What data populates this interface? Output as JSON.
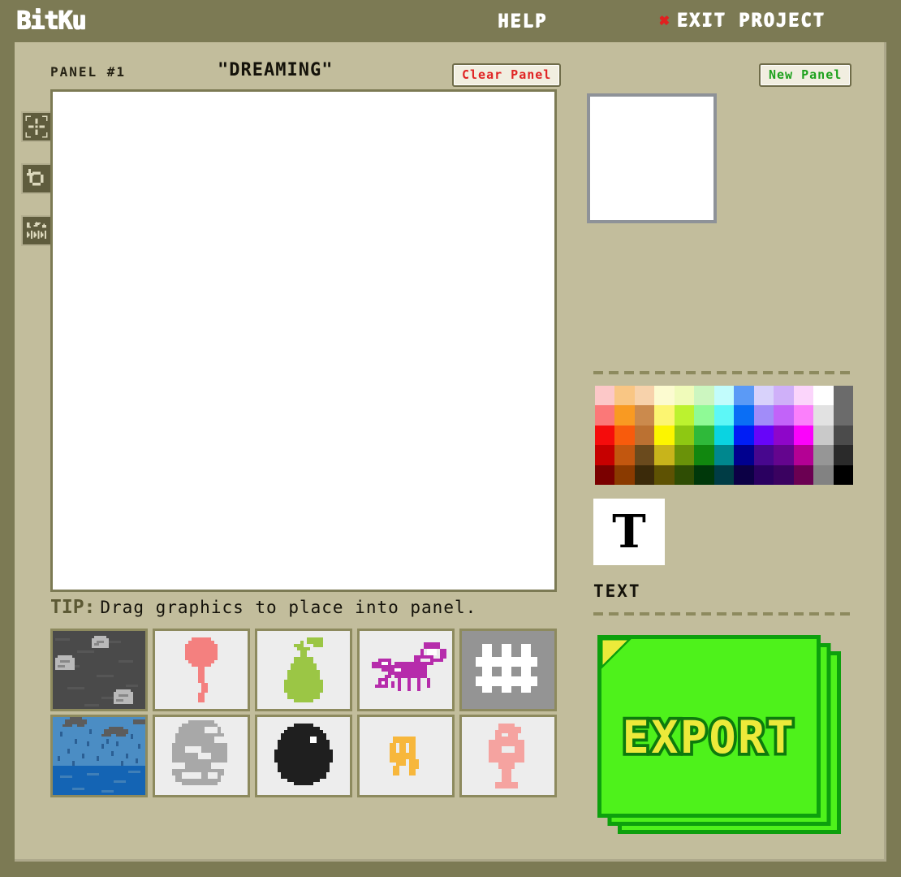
{
  "app": {
    "name": "BitKu",
    "background_color": "#7c7a54",
    "workspace_color": "#c2bd9c"
  },
  "topbar": {
    "logo": "BitKu",
    "help_label": "HELP",
    "exit_icon": "✖",
    "exit_label": "EXIT PROJECT",
    "exit_icon_color": "#e02020"
  },
  "panel_header": {
    "panel_label": "PANEL #1",
    "panel_title": "\"DREAMING\"",
    "clear_panel_label": "Clear Panel",
    "clear_panel_color": "#e02424",
    "new_panel_label": "New Panel",
    "new_panel_color": "#1da11d"
  },
  "tools": [
    {
      "name": "move-resize-tool",
      "icon": "move-arrows-icon"
    },
    {
      "name": "undo-tool",
      "icon": "undo-arrow-icon"
    },
    {
      "name": "frames-tool",
      "icon": "frames-icon"
    }
  ],
  "canvas": {
    "background": "#ffffff",
    "border_color": "#7c7a54"
  },
  "preview": {
    "background": "#ffffff",
    "border_color": "#8e9298"
  },
  "tip": {
    "key": "TIP:",
    "text": "Drag graphics to place into panel."
  },
  "sprites": [
    {
      "name": "rocks-ground-tile",
      "bg": "#4a4a4a",
      "accent": "#b9b9b9"
    },
    {
      "name": "balloon-sprite",
      "bg": "#ededed",
      "accent": "#f4807f"
    },
    {
      "name": "pear-sprite",
      "bg": "#ededed",
      "accent": "#9cc košek"
    },
    {
      "name": "scorpion-sprite",
      "bg": "#ededed",
      "accent": "#b62cab"
    },
    {
      "name": "fence-sprite",
      "bg": "#949494",
      "accent": "#ffffff"
    },
    {
      "name": "rain-sea-tile",
      "bg": "#4b8dc4",
      "accent": "#1464b4"
    },
    {
      "name": "boulder-sprite",
      "bg": "#ededed",
      "accent": "#a8a8a8"
    },
    {
      "name": "black-blob-sprite",
      "bg": "#ededed",
      "accent": "#1f1f1f"
    },
    {
      "name": "orange-critter-sprite",
      "bg": "#ededed",
      "accent": "#f7b73c"
    },
    {
      "name": "pink-robot-sprite",
      "bg": "#ededed",
      "accent": "#f5a3a0"
    }
  ],
  "palette": {
    "columns": 13,
    "rows": 5,
    "colors": [
      [
        "#fcc8c8",
        "#f9c684",
        "#f7d2ab",
        "#fcfbd0",
        "#f0fbba",
        "#ccf6c0",
        "#c2fcfc",
        "#5b9af6",
        "#d8d2fb",
        "#cfb0f9",
        "#fbd5fb",
        "#ffffff",
        "#6b6b6b"
      ],
      [
        "#fb7878",
        "#f99a22",
        "#cb8a4d",
        "#fcf571",
        "#bcf22f",
        "#8ffa96",
        "#5df7f7",
        "#0a6ef5",
        "#a18cf9",
        "#c263f9",
        "#fb7ffb",
        "#e2e2e2",
        "#6b6b6b"
      ],
      [
        "#f50c0c",
        "#f85b0c",
        "#bb7132",
        "#fcf500",
        "#8ec812",
        "#2fb93a",
        "#0ad3e1",
        "#001df5",
        "#6705f9",
        "#8e06c9",
        "#fb03fb",
        "#c9c9c9",
        "#4b4b4b"
      ],
      [
        "#c60000",
        "#c2570f",
        "#6a4a1d",
        "#c8b41b",
        "#6a9209",
        "#11870f",
        "#00878e",
        "#00008e",
        "#47078e",
        "#64058e",
        "#b40194",
        "#969696",
        "#2a2a2a"
      ],
      [
        "#7a0000",
        "#8a3a00",
        "#3b2a0a",
        "#5e5203",
        "#2f4d04",
        "#00380a",
        "#003c45",
        "#0c0045",
        "#2a0060",
        "#3a0260",
        "#6b0052",
        "#828282",
        "#000000"
      ]
    ]
  },
  "text_tool": {
    "glyph": "T",
    "label": "TEXT"
  },
  "export": {
    "label": "EXPORT",
    "page_color": "#4ef21b",
    "outline_color": "#0da00d",
    "label_color": "#ecea3a",
    "fold_color": "#ecea3a"
  }
}
